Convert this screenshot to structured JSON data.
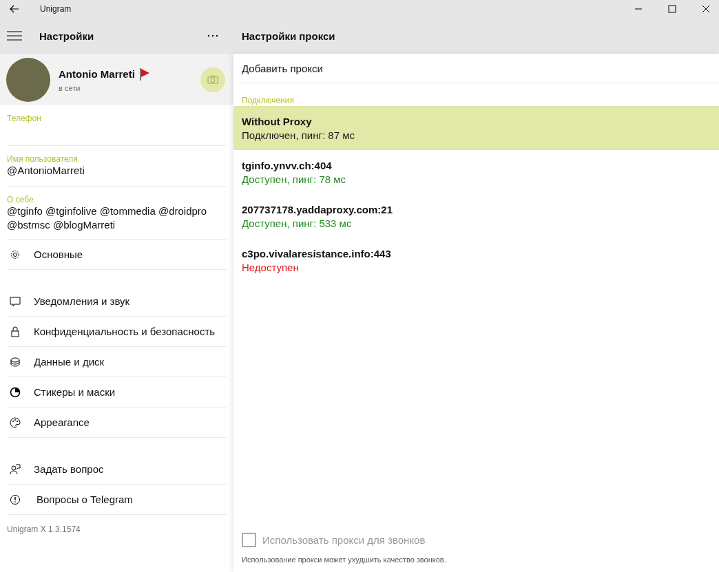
{
  "window": {
    "title": "Unigram"
  },
  "settings_pane": {
    "title": "Настройки",
    "profile": {
      "name": "Antonio Marreti",
      "status": "в сети"
    },
    "fields": [
      {
        "label": "Телефон"
      },
      {
        "label": "Имя пользователя",
        "lines": [
          "@AntonioMarreti"
        ]
      },
      {
        "label": "О себе",
        "lines": [
          "@tginfo @tginfolive @tommedia @droidpro",
          "@bstmsc @blogMarreti"
        ]
      }
    ],
    "menu_groups": [
      [
        {
          "kind": "gear",
          "label": "Основные"
        }
      ],
      [
        {
          "kind": "chat",
          "label": "Уведомления и звук"
        },
        {
          "kind": "lock",
          "label": "Конфиденциальность и безопасность"
        },
        {
          "kind": "disk",
          "label": "Данные и диск"
        },
        {
          "kind": "sticker",
          "label": "Стикеры и маски"
        },
        {
          "kind": "palette",
          "label": "Appearance"
        }
      ],
      [
        {
          "kind": "ask",
          "label": "Задать вопрос"
        },
        {
          "kind": "info",
          "label": "Вопросы о Telegram"
        }
      ]
    ],
    "version": "Unigram X 1.3.1574"
  },
  "proxy_pane": {
    "title": "Настройки прокси",
    "add_button": "Добавить прокси",
    "section": "Подключения",
    "proxies": [
      {
        "name": "Without Proxy",
        "status": "Подключен, пинг: 87 мс",
        "kind": "connected",
        "selected": true
      },
      {
        "name": "tginfo.ynvv.ch:404",
        "status": "Доступен, пинг: 78 мс",
        "kind": "available",
        "selected": false
      },
      {
        "name": "207737178.yaddaproxy.com:21",
        "status": "Доступен, пинг: 533 мс",
        "kind": "available",
        "selected": false
      },
      {
        "name": "c3po.vivalaresistance.info:443",
        "status": "Недоступен",
        "kind": "unavailable",
        "selected": false
      }
    ],
    "calls_checkbox": {
      "label": "Использовать прокси для звонков",
      "checked": false,
      "disabled": true
    },
    "note": "Использование прокси может ухудшить качество звонков."
  }
}
